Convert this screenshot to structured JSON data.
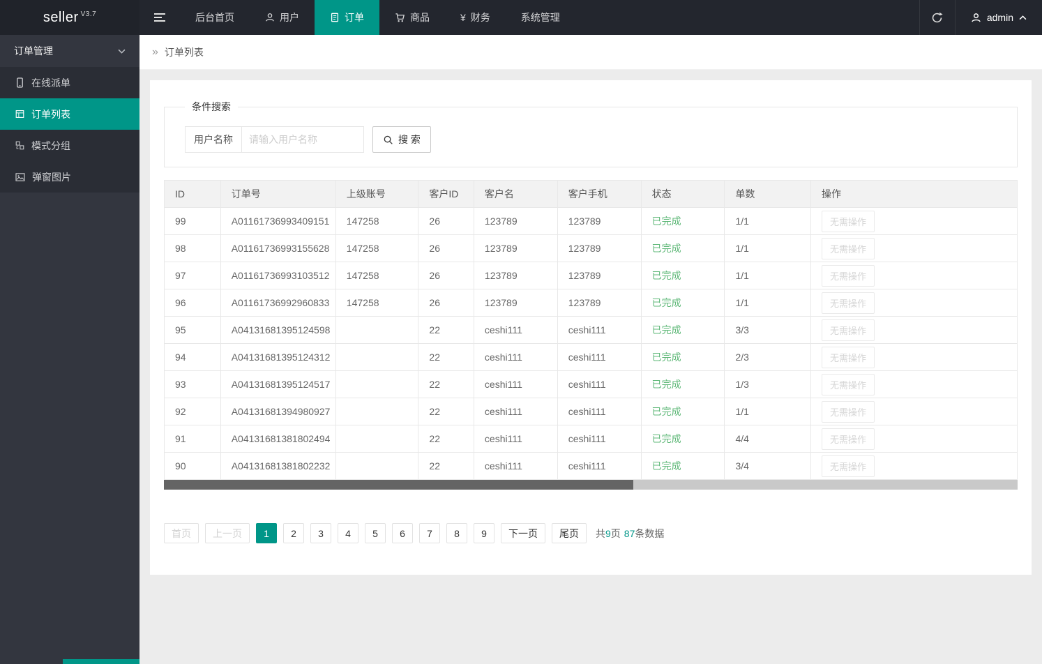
{
  "brand": {
    "name": "seller",
    "version": "V3.7"
  },
  "topnav": {
    "items": [
      {
        "label": "后台首页",
        "active": false
      },
      {
        "label": "用户",
        "icon": "user",
        "active": false
      },
      {
        "label": "订单",
        "icon": "document",
        "active": true
      },
      {
        "label": "商品",
        "icon": "cart",
        "active": false
      },
      {
        "label": "财务",
        "icon": "yen",
        "active": false
      },
      {
        "label": "系统管理",
        "active": false
      }
    ],
    "admin_label": "admin"
  },
  "icons": {
    "yen_glyph": "¥",
    "breadcrumb_glyph": "»"
  },
  "sidebar": {
    "group_label": "订单管理",
    "items": [
      {
        "label": "在线派单",
        "icon": "phone",
        "active": false
      },
      {
        "label": "订单列表",
        "icon": "list",
        "active": true
      },
      {
        "label": "模式分组",
        "icon": "group",
        "active": false
      },
      {
        "label": "弹窗图片",
        "icon": "image",
        "active": false
      }
    ]
  },
  "breadcrumb": {
    "label": "订单列表"
  },
  "search_panel": {
    "legend": "条件搜索",
    "field_label": "用户名称",
    "placeholder": "请输入用户名称",
    "button_label": "搜 索"
  },
  "table": {
    "headers": [
      "ID",
      "订单号",
      "上级账号",
      "客户ID",
      "客户名",
      "客户手机",
      "状态",
      "单数",
      "操作"
    ],
    "rows": [
      {
        "id": "99",
        "order_no": "A01161736993409151",
        "parent_account": "147258",
        "customer_id": "26",
        "customer_name": "123789",
        "customer_phone": "123789",
        "status": "已完成",
        "count": "1/1",
        "action": "无需操作"
      },
      {
        "id": "98",
        "order_no": "A01161736993155628",
        "parent_account": "147258",
        "customer_id": "26",
        "customer_name": "123789",
        "customer_phone": "123789",
        "status": "已完成",
        "count": "1/1",
        "action": "无需操作"
      },
      {
        "id": "97",
        "order_no": "A01161736993103512",
        "parent_account": "147258",
        "customer_id": "26",
        "customer_name": "123789",
        "customer_phone": "123789",
        "status": "已完成",
        "count": "1/1",
        "action": "无需操作"
      },
      {
        "id": "96",
        "order_no": "A01161736992960833",
        "parent_account": "147258",
        "customer_id": "26",
        "customer_name": "123789",
        "customer_phone": "123789",
        "status": "已完成",
        "count": "1/1",
        "action": "无需操作"
      },
      {
        "id": "95",
        "order_no": "A04131681395124598",
        "parent_account": "",
        "customer_id": "22",
        "customer_name": "ceshi111",
        "customer_phone": "ceshi111",
        "status": "已完成",
        "count": "3/3",
        "action": "无需操作"
      },
      {
        "id": "94",
        "order_no": "A04131681395124312",
        "parent_account": "",
        "customer_id": "22",
        "customer_name": "ceshi111",
        "customer_phone": "ceshi111",
        "status": "已完成",
        "count": "2/3",
        "action": "无需操作"
      },
      {
        "id": "93",
        "order_no": "A04131681395124517",
        "parent_account": "",
        "customer_id": "22",
        "customer_name": "ceshi111",
        "customer_phone": "ceshi111",
        "status": "已完成",
        "count": "1/3",
        "action": "无需操作"
      },
      {
        "id": "92",
        "order_no": "A04131681394980927",
        "parent_account": "",
        "customer_id": "22",
        "customer_name": "ceshi111",
        "customer_phone": "ceshi111",
        "status": "已完成",
        "count": "1/1",
        "action": "无需操作"
      },
      {
        "id": "91",
        "order_no": "A04131681381802494",
        "parent_account": "",
        "customer_id": "22",
        "customer_name": "ceshi111",
        "customer_phone": "ceshi111",
        "status": "已完成",
        "count": "4/4",
        "action": "无需操作"
      },
      {
        "id": "90",
        "order_no": "A04131681381802232",
        "parent_account": "",
        "customer_id": "22",
        "customer_name": "ceshi111",
        "customer_phone": "ceshi111",
        "status": "已完成",
        "count": "3/4",
        "action": "无需操作"
      }
    ]
  },
  "pagination": {
    "first": "首页",
    "prev": "上一页",
    "next": "下一页",
    "last": "尾页",
    "pages": [
      "1",
      "2",
      "3",
      "4",
      "5",
      "6",
      "7",
      "8",
      "9"
    ],
    "current": "1",
    "summary": {
      "prefix": "共",
      "total_pages": "9",
      "pages_suffix": "页",
      "total_records": "87",
      "records_suffix": "条数据"
    }
  },
  "colors": {
    "accent": "#009688",
    "status_green": "#5FB878",
    "topbar_bg": "#23262E",
    "sidebar_bg": "#33363F"
  }
}
